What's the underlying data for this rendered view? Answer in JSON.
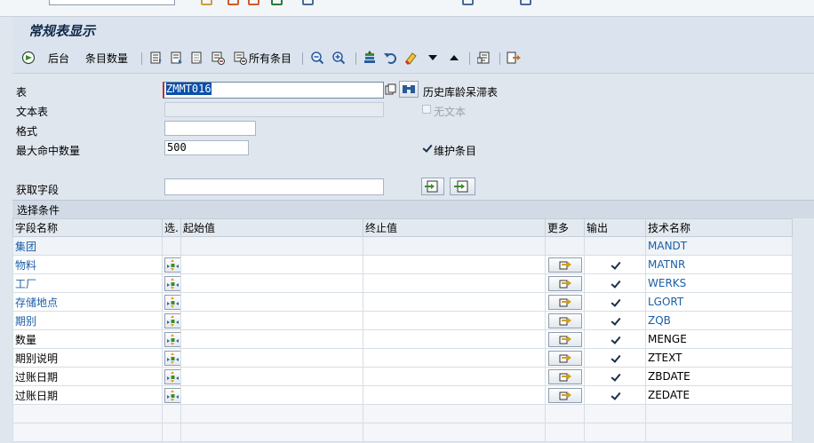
{
  "window": {
    "title": "常规表显示"
  },
  "toolbar": {
    "execute_icon": "execute-icon",
    "background_label": "后台",
    "entry_count_label": "条目数量",
    "all_entries_label": "所有条目"
  },
  "form": {
    "table_label": "表",
    "table_value": "ZMMT016",
    "table_desc": "历史库龄呆滞表",
    "text_table_label": "文本表",
    "text_table_value": "",
    "no_text_label": "无文本",
    "width_label": "格式",
    "width_value": "",
    "max_hits_label": "最大命中数量",
    "max_hits_value": "500",
    "maintain_entries_label": "维护条目",
    "get_fields_label": "获取字段",
    "get_fields_value": ""
  },
  "section": {
    "title": "选择条件"
  },
  "grid": {
    "headers": [
      "字段名称",
      "选.",
      "起始值",
      "终止值",
      "更多",
      "输出",
      "技术名称"
    ],
    "rows": [
      {
        "name": "集团",
        "tech": "MANDT",
        "key": true,
        "editable": false,
        "output": false
      },
      {
        "name": "物料",
        "tech": "MATNR",
        "key": true,
        "editable": true,
        "output": true
      },
      {
        "name": "工厂",
        "tech": "WERKS",
        "key": true,
        "editable": true,
        "output": true
      },
      {
        "name": "存储地点",
        "tech": "LGORT",
        "key": true,
        "editable": true,
        "output": true
      },
      {
        "name": "期别",
        "tech": "ZQB",
        "key": true,
        "editable": true,
        "output": true
      },
      {
        "name": "数量",
        "tech": "MENGE",
        "key": false,
        "editable": true,
        "output": true
      },
      {
        "name": "期别说明",
        "tech": "ZTEXT",
        "key": false,
        "editable": true,
        "output": true
      },
      {
        "name": "过账日期",
        "tech": "ZBDATE",
        "key": false,
        "editable": true,
        "output": true
      },
      {
        "name": "过账日期",
        "tech": "ZEDATE",
        "key": false,
        "editable": true,
        "output": true
      }
    ]
  },
  "colors": {
    "key_text": "#1a5ea8",
    "selection": "#0a4fa8",
    "toolbar_bg": "#dbe4ee"
  }
}
